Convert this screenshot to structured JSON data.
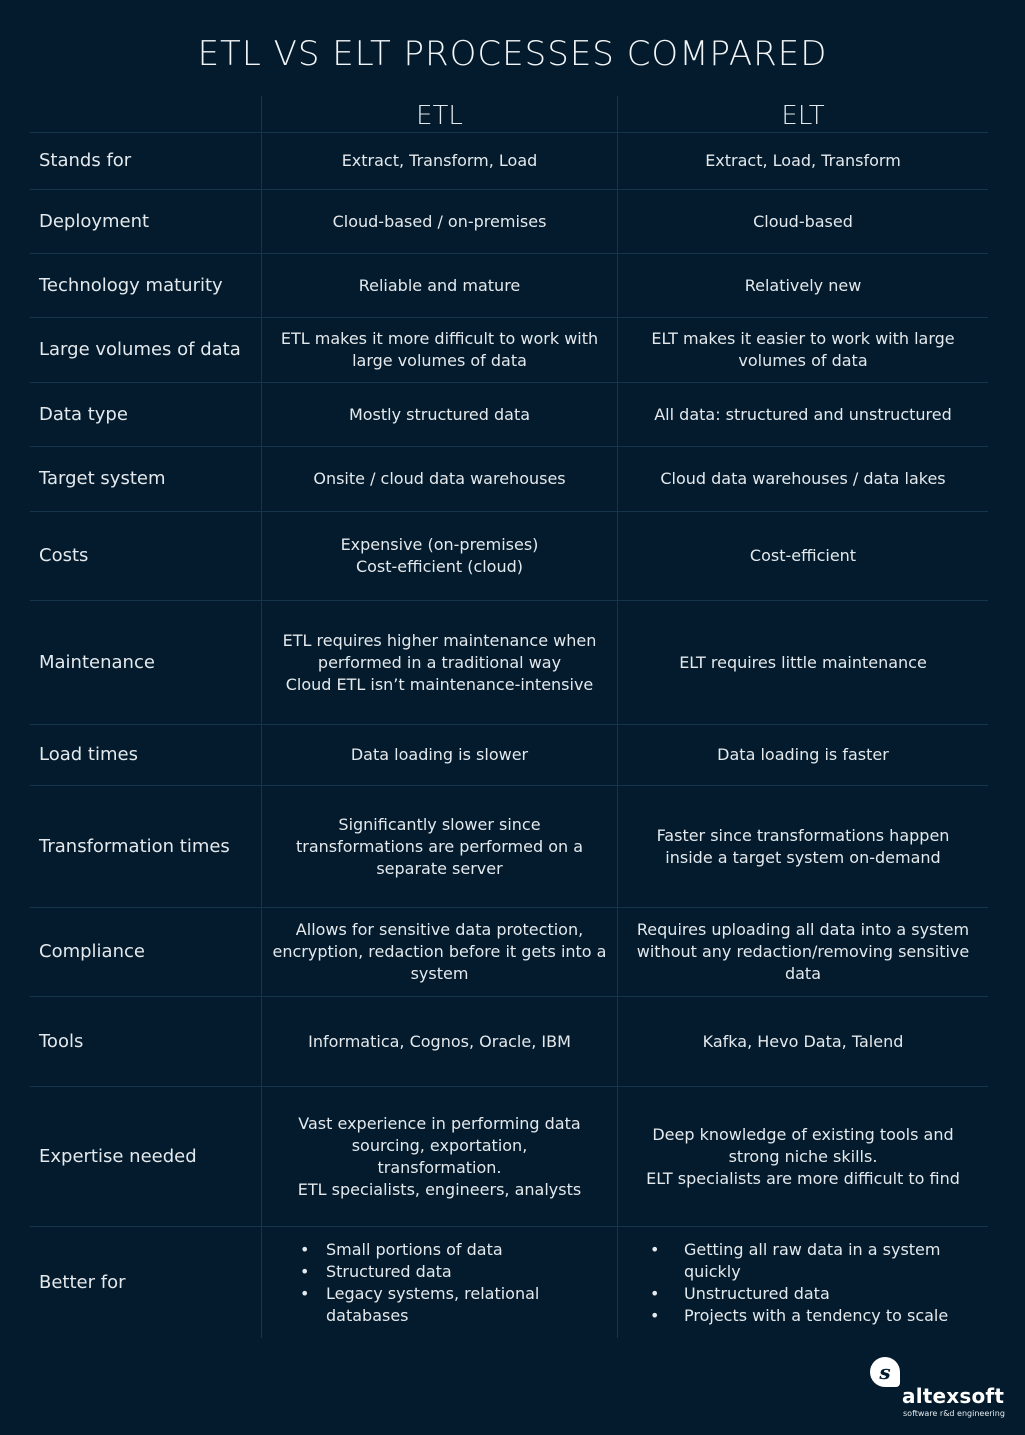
{
  "title": "ETL VS ELT PROCESSES COMPARED",
  "columns": [
    "",
    "ETL",
    "ELT"
  ],
  "rows": [
    {
      "label": "Stands for",
      "etl": "Extract, Transform, Load",
      "elt": "Extract, Load, Transform"
    },
    {
      "label": "Deployment",
      "etl": "Cloud-based / on-premises",
      "elt": "Cloud-based"
    },
    {
      "label": "Technology maturity",
      "etl": "Reliable and mature",
      "elt": "Relatively new"
    },
    {
      "label": "Large volumes of data",
      "etl": "ETL makes it more difficult to work with large volumes of data",
      "elt": "ELT makes it easier to work with large volumes of data"
    },
    {
      "label": "Data type",
      "etl": "Mostly structured data",
      "elt": "All data: structured and unstructured"
    },
    {
      "label": "Target system",
      "etl": "Onsite / cloud data warehouses",
      "elt": "Cloud data warehouses / data lakes"
    },
    {
      "label": "Costs",
      "etl": "Expensive (on-premises)\nCost-efficient (cloud)",
      "elt": "Cost-efficient"
    },
    {
      "label": "Maintenance",
      "etl": "ETL requires higher maintenance when performed in a traditional way\nCloud ETL isn’t maintenance-intensive",
      "elt": "ELT requires little maintenance"
    },
    {
      "label": "Load times",
      "etl": "Data loading is slower",
      "elt": "Data loading is faster"
    },
    {
      "label": "Transformation times",
      "etl": "Significantly slower since transformations are performed on a separate server",
      "elt": "Faster since transformations happen inside a target system on-demand"
    },
    {
      "label": "Compliance",
      "etl": "Allows for sensitive data protection, encryption, redaction before it gets into a system",
      "elt": "Requires uploading all data into a system without any redaction/removing sensitive data"
    },
    {
      "label": "Tools",
      "etl": "Informatica, Cognos, Oracle, IBM",
      "elt": "Kafka, Hevo Data, Talend"
    },
    {
      "label": "Expertise needed",
      "etl": "Vast experience in performing data sourcing, exportation, transformation.\nETL specialists, engineers, analysts",
      "elt": "Deep knowledge of existing tools and strong niche skills.\nELT specialists are more difficult to find"
    }
  ],
  "better_for": {
    "label": "Better for",
    "etl": [
      "Small portions of data",
      "Structured data",
      "Legacy systems, relational databases"
    ],
    "elt": [
      "Getting all raw data in a system quickly",
      "Unstructured data",
      "Projects with a tendency to scale"
    ]
  },
  "logo": {
    "mark": "s",
    "name": "altexsoft",
    "tagline": "software r&d engineering",
    "icon": "altexsoft-logo-icon"
  }
}
